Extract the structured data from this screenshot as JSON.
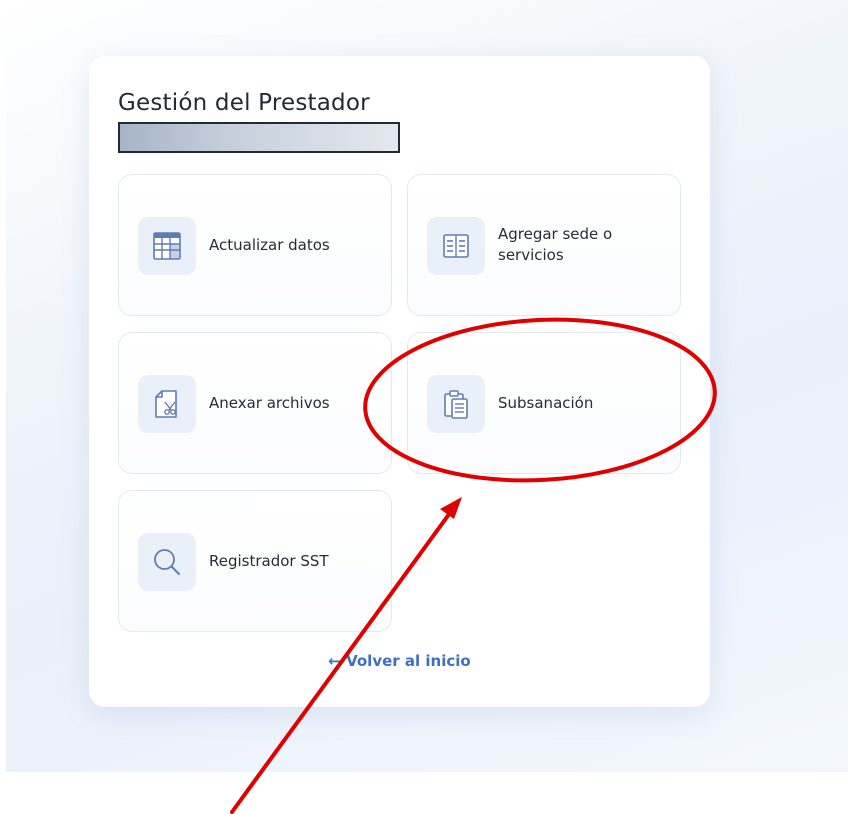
{
  "panel": {
    "title": "Gestión del Prestador"
  },
  "tiles": [
    {
      "label": "Actualizar datos",
      "icon": "spreadsheet-icon"
    },
    {
      "label": "Agregar sede o servicios",
      "icon": "document-columns-icon"
    },
    {
      "label": "Anexar archivos",
      "icon": "file-scissors-icon"
    },
    {
      "label": "Subsanación",
      "icon": "clipboard-icon"
    },
    {
      "label": "Registrador SST",
      "icon": "search-icon"
    }
  ],
  "footer": {
    "back_link": "← Volver al inicio"
  },
  "colors": {
    "accent": "#3d6fc2",
    "icon_stroke": "#5d7db2",
    "icon_background": "#eaf0fa",
    "annotation_red": "#e00000"
  }
}
